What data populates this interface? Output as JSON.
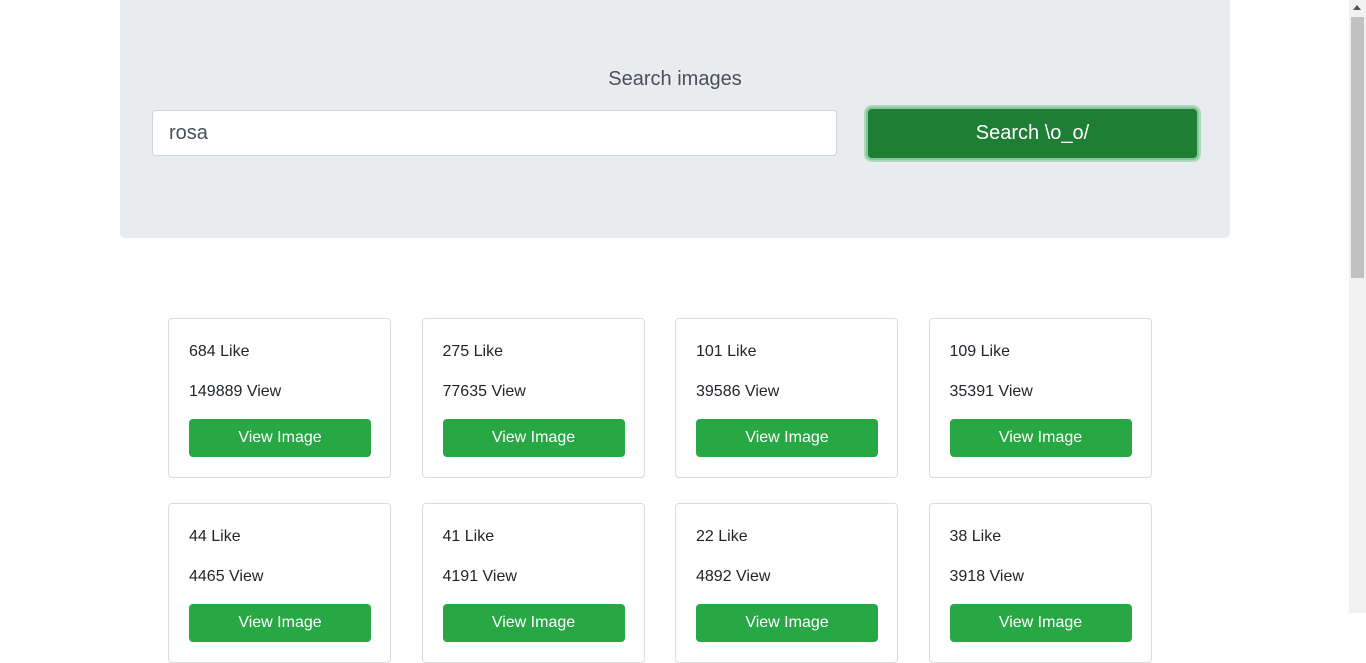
{
  "search": {
    "title": "Search images",
    "value": "rosa",
    "button_label": "Search \\o_o/"
  },
  "results": [
    {
      "likes": "684 Like",
      "views": "149889 View",
      "button_label": "View Image"
    },
    {
      "likes": "275 Like",
      "views": "77635 View",
      "button_label": "View Image"
    },
    {
      "likes": "101 Like",
      "views": "39586 View",
      "button_label": "View Image"
    },
    {
      "likes": "109 Like",
      "views": "35391 View",
      "button_label": "View Image"
    },
    {
      "likes": "44 Like",
      "views": "4465 View",
      "button_label": "View Image"
    },
    {
      "likes": "41 Like",
      "views": "4191 View",
      "button_label": "View Image"
    },
    {
      "likes": "22 Like",
      "views": "4892 View",
      "button_label": "View Image"
    },
    {
      "likes": "38 Like",
      "views": "3918 View",
      "button_label": "View Image"
    }
  ],
  "colors": {
    "primary_button": "#28a745",
    "search_button_active": "#1e7e34",
    "jumbotron_bg": "#e9ecef"
  }
}
